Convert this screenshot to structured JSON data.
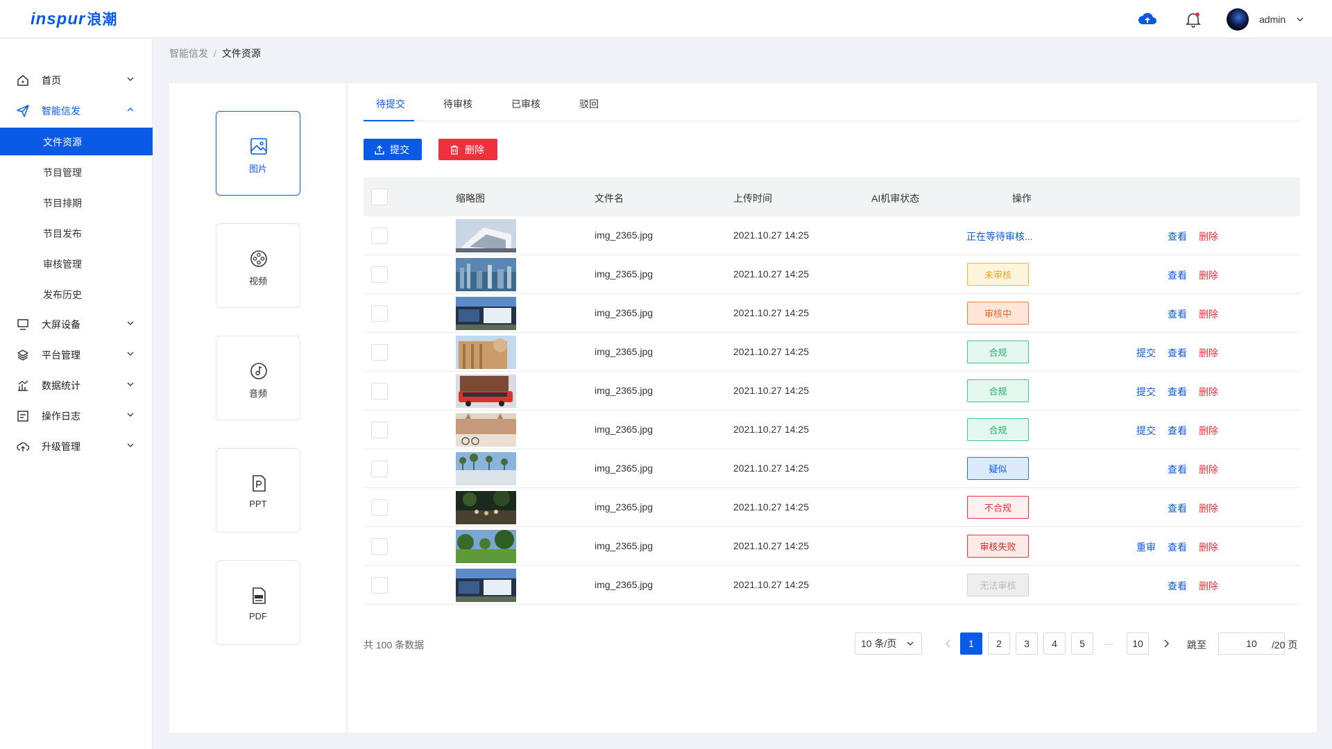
{
  "header": {
    "logo_text": "inspur",
    "logo_cn": "浪潮",
    "user_name": "admin",
    "accent_color": "#0a5ae6"
  },
  "sidebar": {
    "items": [
      {
        "label": "首页",
        "icon": "home-icon"
      },
      {
        "label": "智能信发",
        "icon": "send-icon",
        "open": true,
        "children": [
          "文件资源",
          "节目管理",
          "节目排期",
          "节目发布",
          "审核管理",
          "发布历史"
        ]
      },
      {
        "label": "大屏设备",
        "icon": "monitor-icon"
      },
      {
        "label": "平台管理",
        "icon": "layers-icon"
      },
      {
        "label": "数据统计",
        "icon": "chart-icon"
      },
      {
        "label": "操作日志",
        "icon": "log-icon"
      },
      {
        "label": "升级管理",
        "icon": "upgrade-icon"
      }
    ],
    "active_child": "文件资源"
  },
  "breadcrumb": {
    "parent": "智能信发",
    "separator": "/",
    "current": "文件资源"
  },
  "file_types": [
    {
      "label": "图片",
      "icon": "image-icon",
      "active": true
    },
    {
      "label": "视频",
      "icon": "film-icon"
    },
    {
      "label": "音频",
      "icon": "audio-icon"
    },
    {
      "label": "PPT",
      "icon": "ppt-icon"
    },
    {
      "label": "PDF",
      "icon": "pdf-icon"
    }
  ],
  "tabs": [
    "待提交",
    "待审核",
    "已审核",
    "驳回"
  ],
  "toolbar": {
    "submit_label": "提交",
    "delete_label": "删除"
  },
  "table": {
    "columns": [
      "缩略图",
      "文件名",
      "上传时间",
      "AI机审状态",
      "操作"
    ],
    "rows": [
      {
        "file": "img_2365.jpg",
        "time": "2021.10.27  14:25",
        "status": "正在等待审核...",
        "status_kind": "pending-text",
        "thumb": "building-white",
        "ops": [
          "查看",
          "删除"
        ]
      },
      {
        "file": "img_2365.jpg",
        "time": "2021.10.27  14:25",
        "status": "未审核",
        "status_kind": "unreviewed",
        "thumb": "city-skyline",
        "ops": [
          "查看",
          "删除"
        ]
      },
      {
        "file": "img_2365.jpg",
        "time": "2021.10.27  14:25",
        "status": "审核中",
        "status_kind": "reviewing",
        "thumb": "office-building",
        "ops": [
          "查看",
          "删除"
        ]
      },
      {
        "file": "img_2365.jpg",
        "time": "2021.10.27  14:25",
        "status": "合规",
        "status_kind": "compliant",
        "thumb": "tan-building",
        "ops": [
          "提交",
          "查看",
          "删除"
        ]
      },
      {
        "file": "img_2365.jpg",
        "time": "2021.10.27  14:25",
        "status": "合规",
        "status_kind": "compliant",
        "thumb": "red-bus",
        "ops": [
          "提交",
          "查看",
          "删除"
        ]
      },
      {
        "file": "img_2365.jpg",
        "time": "2021.10.27  14:25",
        "status": "合规",
        "status_kind": "compliant",
        "thumb": "square-cyclist",
        "ops": [
          "提交",
          "查看",
          "删除"
        ]
      },
      {
        "file": "img_2365.jpg",
        "time": "2021.10.27  14:25",
        "status": "疑似",
        "status_kind": "suspected",
        "thumb": "palm-plaza",
        "ops": [
          "查看",
          "删除"
        ]
      },
      {
        "file": "img_2365.jpg",
        "time": "2021.10.27  14:25",
        "status": "不合规",
        "status_kind": "noncompliant",
        "thumb": "crowd-night",
        "ops": [
          "查看",
          "删除"
        ]
      },
      {
        "file": "img_2365.jpg",
        "time": "2021.10.27  14:25",
        "status": "审核失败",
        "status_kind": "failed",
        "thumb": "green-park",
        "ops": [
          "重审",
          "查看",
          "删除"
        ]
      },
      {
        "file": "img_2365.jpg",
        "time": "2021.10.27  14:25",
        "status": "无法审核",
        "status_kind": "unable",
        "thumb": "office-building",
        "ops": [
          "查看",
          "删除"
        ]
      }
    ]
  },
  "pagination": {
    "total_text": "共 100 条数据",
    "page_size": "10 条/页",
    "pages": [
      "1",
      "2",
      "3",
      "4",
      "5"
    ],
    "ellipsis": "···",
    "last_page": "10",
    "current_page": "1",
    "jump_label": "跳至",
    "jump_value": "10",
    "total_pages_text": "/20 页"
  },
  "status_colors": {
    "unreviewed": {
      "bg": "#fff4dc",
      "border": "#f5b53c",
      "text": "#f5a623"
    },
    "reviewing": {
      "bg": "#ffe6d8",
      "border": "#f07c44",
      "text": "#f06a28"
    },
    "compliant": {
      "bg": "#e4f8ef",
      "border": "#3cc88a",
      "text": "#1fb070"
    },
    "suspected": {
      "bg": "#dde9fc",
      "border": "#2f6fe6",
      "text": "#0a5ae6"
    },
    "noncompliant": {
      "bg": "#fff0f0",
      "border": "#f0303c",
      "text": "#f0303c"
    },
    "failed": {
      "bg": "#ffe9e9",
      "border": "#e23a3a",
      "text": "#d42a2a"
    },
    "unable": {
      "bg": "#eeeeee",
      "border": "#d4d4d4",
      "text": "#b8b8b8"
    }
  }
}
